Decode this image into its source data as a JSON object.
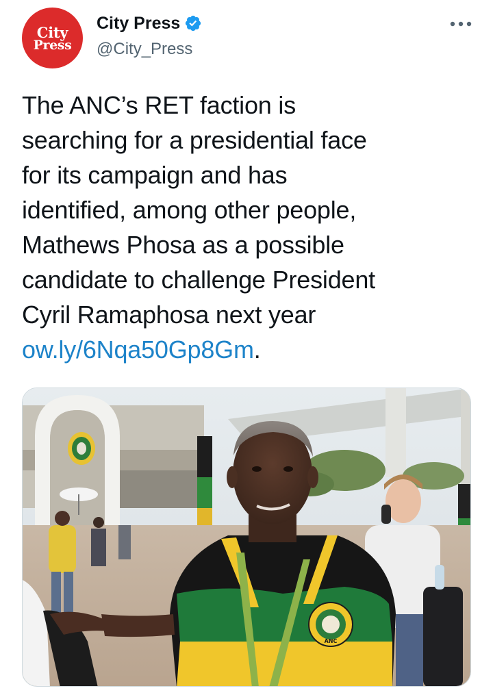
{
  "account": {
    "avatar_logo_line1": "City",
    "avatar_logo_line2": "Press",
    "display_name": "City Press",
    "handle": "@City_Press",
    "verified": true
  },
  "icons": {
    "verified": "verified-badge-icon",
    "more": "more-options-icon"
  },
  "tweet": {
    "text_lines": [
      "The ANC’s RET faction is",
      "searching for a presidential face",
      "for its campaign and has",
      "identified, among other people,",
      "Mathews Phosa as a possible",
      "candidate to challenge President",
      "Cyril Ramaphosa next year"
    ],
    "link": "ow.ly/6Nqa50Gp8Gm",
    "link_trailing": ".",
    "media_logo_text": "ANC"
  },
  "colors": {
    "brand_red": "#dc2b2b",
    "verified_blue": "#1d9bf0",
    "link_blue": "#1d83c9",
    "handle_grey": "#536471"
  }
}
